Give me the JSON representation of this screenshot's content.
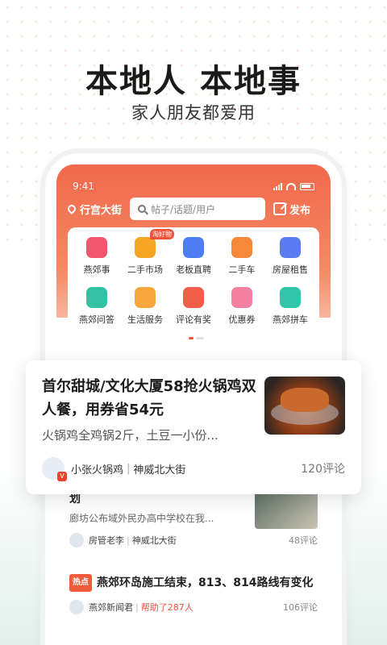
{
  "promo": {
    "headline": "本地人 本地事",
    "subline": "家人朋友都爱用"
  },
  "status_bar": {
    "time": "9:41"
  },
  "header": {
    "location": "行宫大街",
    "search_placeholder": "帖子/话题/用户",
    "post_label": "发布"
  },
  "categories": [
    {
      "label": "燕郊事",
      "icon": "news-icon",
      "color": "#f0576e"
    },
    {
      "label": "二手市场",
      "icon": "basket-icon",
      "color": "#f5a524",
      "badge": "淘好物"
    },
    {
      "label": "老板直聘",
      "icon": "tie-icon",
      "color": "#4d7ef3"
    },
    {
      "label": "二手车",
      "icon": "car-icon",
      "color": "#f7883a"
    },
    {
      "label": "房屋租售",
      "icon": "building-icon",
      "color": "#5b7cf0"
    },
    {
      "label": "燕郊问答",
      "icon": "chat-icon",
      "color": "#33c2a1"
    },
    {
      "label": "生活服务",
      "icon": "house-icon",
      "color": "#f7a73b"
    },
    {
      "label": "评论有奖",
      "icon": "gift-icon",
      "color": "#f25d4a"
    },
    {
      "label": "优惠券",
      "icon": "coupon-icon",
      "color": "#f47fa0"
    },
    {
      "label": "燕郊拼车",
      "icon": "carpool-icon",
      "color": "#31c6a8"
    }
  ],
  "feed": [
    {
      "title": "划",
      "summary": "廊坊公布域外民办高中学校在我...",
      "author": "房管老李",
      "location": "神威北大街",
      "comments": "48评论"
    },
    {
      "tag": "热点",
      "title": "燕郊环岛施工结束，813、814路线有变化",
      "author": "燕郊新闻君",
      "help": "帮助了287人",
      "comments": "106评论"
    }
  ],
  "featured": {
    "title": "首尔甜城/文化大厦58抢火锅鸡双人餐，用券省54元",
    "desc": "火锅鸡全鸡锅2斤，土豆一小份...",
    "author": "小张火锅鸡",
    "location": "神威北大街",
    "comments": "120评论",
    "verified_mark": "V"
  }
}
